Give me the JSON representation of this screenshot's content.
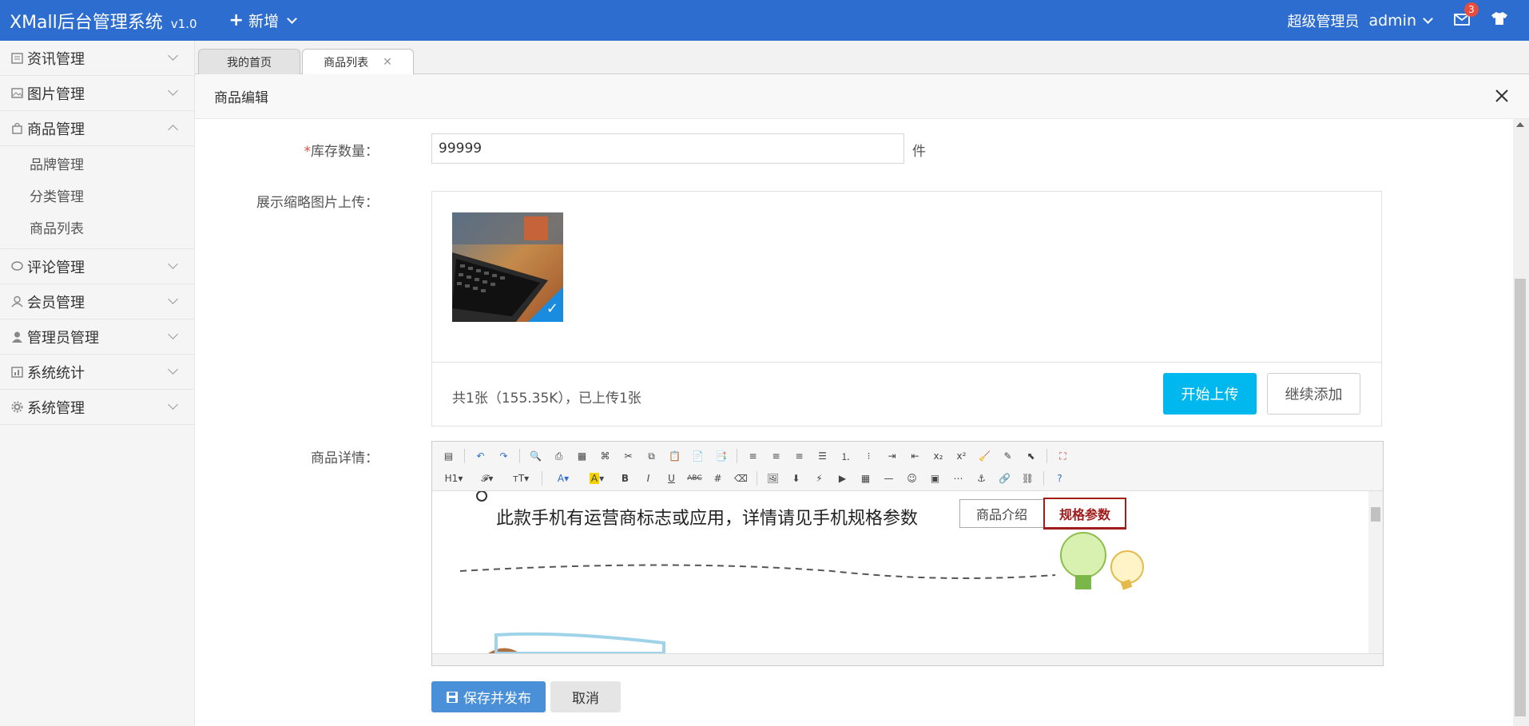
{
  "header": {
    "brand": "XMall后台管理系统",
    "version": "v1.0",
    "add_label": "新增",
    "user_role": "超级管理员",
    "user_name": "admin",
    "mail_count": "3",
    "colors": {
      "topbar": "#2d6dd0"
    }
  },
  "sidebar": {
    "items": [
      {
        "label": "资讯管理",
        "icon": "news-icon"
      },
      {
        "label": "图片管理",
        "icon": "image-icon"
      },
      {
        "label": "商品管理",
        "icon": "bag-icon"
      },
      {
        "label": "评论管理",
        "icon": "comment-icon"
      },
      {
        "label": "会员管理",
        "icon": "user-icon"
      },
      {
        "label": "管理员管理",
        "icon": "admin-icon"
      },
      {
        "label": "系统统计",
        "icon": "stats-icon"
      },
      {
        "label": "系统管理",
        "icon": "gear-icon"
      }
    ],
    "sub_items": [
      "品牌管理",
      "分类管理",
      "商品列表"
    ]
  },
  "tabs": [
    {
      "label": "我的首页"
    },
    {
      "label": "商品列表"
    }
  ],
  "modal": {
    "title": "商品编辑"
  },
  "form": {
    "stock_label": "库存数量：",
    "stock_required": "*",
    "stock_value": "99999",
    "stock_unit": "件",
    "thumb_label": "展示缩略图片上传：",
    "upload_status": "共1张（155.35K），已上传1张",
    "start_upload": "开始上传",
    "continue_add": "继续添加",
    "detail_label": "商品详情：",
    "editor_text": "此款手机有运营商标志或应用，详情请见手机规格参数",
    "editor_tab1": "商品介绍",
    "editor_tab2": "规格参数",
    "save_label": "保存并发布",
    "cancel_label": "取消"
  },
  "toolbar": {
    "heading": "H1",
    "bold": "B",
    "italic": "I",
    "underline": "U",
    "strike": "ABC"
  }
}
